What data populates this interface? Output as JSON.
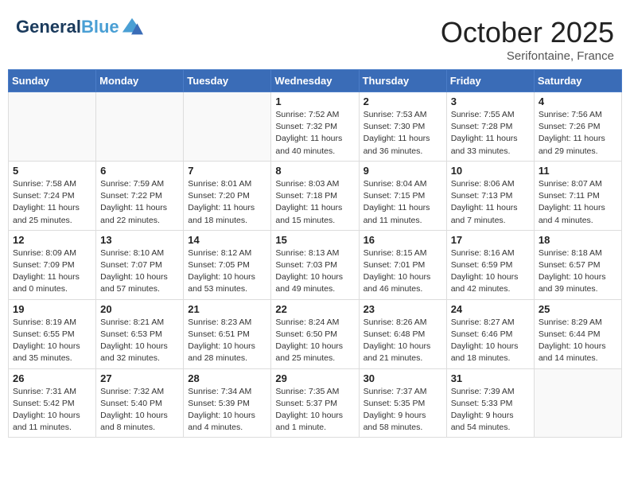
{
  "header": {
    "logo_line1": "General",
    "logo_line2": "Blue",
    "month": "October 2025",
    "location": "Serifontaine, France"
  },
  "days_of_week": [
    "Sunday",
    "Monday",
    "Tuesday",
    "Wednesday",
    "Thursday",
    "Friday",
    "Saturday"
  ],
  "weeks": [
    [
      {
        "num": "",
        "info": ""
      },
      {
        "num": "",
        "info": ""
      },
      {
        "num": "",
        "info": ""
      },
      {
        "num": "1",
        "info": "Sunrise: 7:52 AM\nSunset: 7:32 PM\nDaylight: 11 hours\nand 40 minutes."
      },
      {
        "num": "2",
        "info": "Sunrise: 7:53 AM\nSunset: 7:30 PM\nDaylight: 11 hours\nand 36 minutes."
      },
      {
        "num": "3",
        "info": "Sunrise: 7:55 AM\nSunset: 7:28 PM\nDaylight: 11 hours\nand 33 minutes."
      },
      {
        "num": "4",
        "info": "Sunrise: 7:56 AM\nSunset: 7:26 PM\nDaylight: 11 hours\nand 29 minutes."
      }
    ],
    [
      {
        "num": "5",
        "info": "Sunrise: 7:58 AM\nSunset: 7:24 PM\nDaylight: 11 hours\nand 25 minutes."
      },
      {
        "num": "6",
        "info": "Sunrise: 7:59 AM\nSunset: 7:22 PM\nDaylight: 11 hours\nand 22 minutes."
      },
      {
        "num": "7",
        "info": "Sunrise: 8:01 AM\nSunset: 7:20 PM\nDaylight: 11 hours\nand 18 minutes."
      },
      {
        "num": "8",
        "info": "Sunrise: 8:03 AM\nSunset: 7:18 PM\nDaylight: 11 hours\nand 15 minutes."
      },
      {
        "num": "9",
        "info": "Sunrise: 8:04 AM\nSunset: 7:15 PM\nDaylight: 11 hours\nand 11 minutes."
      },
      {
        "num": "10",
        "info": "Sunrise: 8:06 AM\nSunset: 7:13 PM\nDaylight: 11 hours\nand 7 minutes."
      },
      {
        "num": "11",
        "info": "Sunrise: 8:07 AM\nSunset: 7:11 PM\nDaylight: 11 hours\nand 4 minutes."
      }
    ],
    [
      {
        "num": "12",
        "info": "Sunrise: 8:09 AM\nSunset: 7:09 PM\nDaylight: 11 hours\nand 0 minutes."
      },
      {
        "num": "13",
        "info": "Sunrise: 8:10 AM\nSunset: 7:07 PM\nDaylight: 10 hours\nand 57 minutes."
      },
      {
        "num": "14",
        "info": "Sunrise: 8:12 AM\nSunset: 7:05 PM\nDaylight: 10 hours\nand 53 minutes."
      },
      {
        "num": "15",
        "info": "Sunrise: 8:13 AM\nSunset: 7:03 PM\nDaylight: 10 hours\nand 49 minutes."
      },
      {
        "num": "16",
        "info": "Sunrise: 8:15 AM\nSunset: 7:01 PM\nDaylight: 10 hours\nand 46 minutes."
      },
      {
        "num": "17",
        "info": "Sunrise: 8:16 AM\nSunset: 6:59 PM\nDaylight: 10 hours\nand 42 minutes."
      },
      {
        "num": "18",
        "info": "Sunrise: 8:18 AM\nSunset: 6:57 PM\nDaylight: 10 hours\nand 39 minutes."
      }
    ],
    [
      {
        "num": "19",
        "info": "Sunrise: 8:19 AM\nSunset: 6:55 PM\nDaylight: 10 hours\nand 35 minutes."
      },
      {
        "num": "20",
        "info": "Sunrise: 8:21 AM\nSunset: 6:53 PM\nDaylight: 10 hours\nand 32 minutes."
      },
      {
        "num": "21",
        "info": "Sunrise: 8:23 AM\nSunset: 6:51 PM\nDaylight: 10 hours\nand 28 minutes."
      },
      {
        "num": "22",
        "info": "Sunrise: 8:24 AM\nSunset: 6:50 PM\nDaylight: 10 hours\nand 25 minutes."
      },
      {
        "num": "23",
        "info": "Sunrise: 8:26 AM\nSunset: 6:48 PM\nDaylight: 10 hours\nand 21 minutes."
      },
      {
        "num": "24",
        "info": "Sunrise: 8:27 AM\nSunset: 6:46 PM\nDaylight: 10 hours\nand 18 minutes."
      },
      {
        "num": "25",
        "info": "Sunrise: 8:29 AM\nSunset: 6:44 PM\nDaylight: 10 hours\nand 14 minutes."
      }
    ],
    [
      {
        "num": "26",
        "info": "Sunrise: 7:31 AM\nSunset: 5:42 PM\nDaylight: 10 hours\nand 11 minutes."
      },
      {
        "num": "27",
        "info": "Sunrise: 7:32 AM\nSunset: 5:40 PM\nDaylight: 10 hours\nand 8 minutes."
      },
      {
        "num": "28",
        "info": "Sunrise: 7:34 AM\nSunset: 5:39 PM\nDaylight: 10 hours\nand 4 minutes."
      },
      {
        "num": "29",
        "info": "Sunrise: 7:35 AM\nSunset: 5:37 PM\nDaylight: 10 hours\nand 1 minute."
      },
      {
        "num": "30",
        "info": "Sunrise: 7:37 AM\nSunset: 5:35 PM\nDaylight: 9 hours\nand 58 minutes."
      },
      {
        "num": "31",
        "info": "Sunrise: 7:39 AM\nSunset: 5:33 PM\nDaylight: 9 hours\nand 54 minutes."
      },
      {
        "num": "",
        "info": ""
      }
    ]
  ]
}
